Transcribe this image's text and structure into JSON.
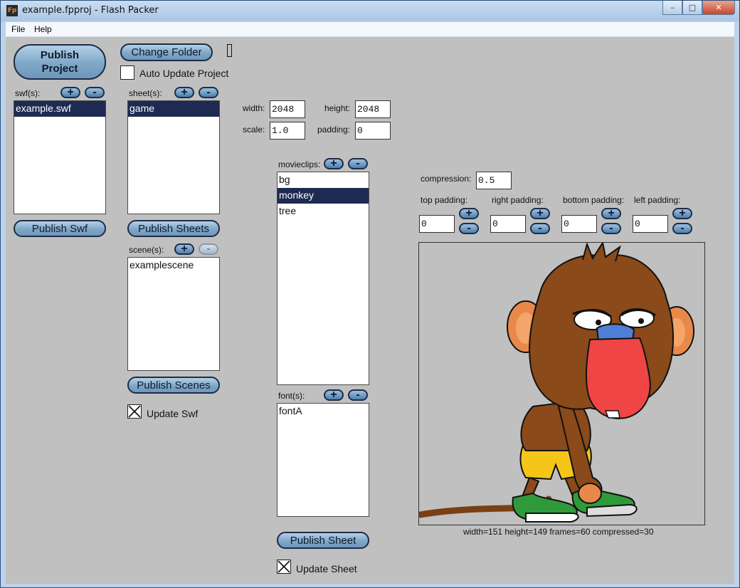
{
  "window": {
    "title": "example.fpproj - Flash Packer",
    "app_icon": "Fp",
    "controls": {
      "minimize": "–",
      "maximize": "□",
      "close": "✕"
    }
  },
  "menu": {
    "items": [
      "File",
      "Help"
    ]
  },
  "project": {
    "publish_project_line1": "Publish",
    "publish_project_line2": "Project",
    "change_folder_label": "Change Folder",
    "auto_update_label": "Auto Update Project",
    "auto_update_checked": false
  },
  "swfs": {
    "label": "swf(s):",
    "items": [
      "example.swf"
    ],
    "selected": "example.swf",
    "publish_label": "Publish Swf",
    "add": "+",
    "remove": "-"
  },
  "sheets": {
    "label": "sheet(s):",
    "items": [
      "game"
    ],
    "selected": "game",
    "publish_label": "Publish Sheets",
    "add": "+",
    "remove": "-"
  },
  "scenes": {
    "label": "scene(s):",
    "items": [
      "examplescene"
    ],
    "publish_label": "Publish Scenes",
    "add": "+",
    "remove": "-",
    "update_swf_label": "Update Swf",
    "update_swf_checked": true
  },
  "sheet_settings": {
    "width_label": "width:",
    "width_value": "2048",
    "height_label": "height:",
    "height_value": "2048",
    "scale_label": "scale:",
    "scale_value": "1.0",
    "padding_label": "padding:",
    "padding_value": "0"
  },
  "movieclips": {
    "label": "movieclips:",
    "items": [
      "bg",
      "monkey",
      "tree"
    ],
    "selected": "monkey",
    "add": "+",
    "remove": "-"
  },
  "fonts": {
    "label": "font(s):",
    "items": [
      "fontA"
    ],
    "add": "+",
    "remove": "-"
  },
  "sheet_actions": {
    "publish_label": "Publish Sheet",
    "update_label": "Update Sheet",
    "update_checked": true
  },
  "clip_settings": {
    "compression_label": "compression:",
    "compression_value": "0.5",
    "top_padding_label": "top padding:",
    "top_padding_value": "0",
    "right_padding_label": "right padding:",
    "right_padding_value": "0",
    "bottom_padding_label": "bottom padding:",
    "bottom_padding_value": "0",
    "left_padding_label": "left padding:",
    "left_padding_value": "0",
    "plus": "+",
    "minus": "-"
  },
  "preview": {
    "info": "width=151 height=149 frames=60 compressed=30"
  }
}
